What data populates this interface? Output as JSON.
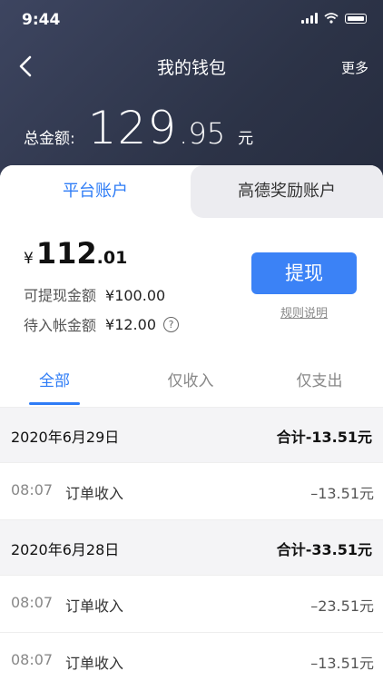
{
  "status": {
    "time": "9:44"
  },
  "nav": {
    "title": "我的钱包",
    "more": "更多"
  },
  "total": {
    "label": "总金额:",
    "int": "129",
    "dec": ".95",
    "unit": "元"
  },
  "account_tabs": {
    "active": "平台账户",
    "inactive": "高德奖励账户"
  },
  "balance": {
    "currency": "¥",
    "int": "112",
    "dec": ".01"
  },
  "withdrawable": {
    "label": "可提现金额",
    "value": "¥100.00"
  },
  "pending": {
    "label": "待入帐金额",
    "value": "¥12.00",
    "help": "?"
  },
  "actions": {
    "withdraw": "提现",
    "rules": "规则说明"
  },
  "filters": [
    "全部",
    "仅收入",
    "仅支出"
  ],
  "groups": [
    {
      "date": "2020年6月29日",
      "sum": "合计-13.51元",
      "rows": [
        {
          "time": "08:07",
          "name": "订单收入",
          "amount": "–13.51元"
        }
      ]
    },
    {
      "date": "2020年6月28日",
      "sum": "合计-33.51元",
      "rows": [
        {
          "time": "08:07",
          "name": "订单收入",
          "amount": "–23.51元"
        },
        {
          "time": "08:07",
          "name": "订单收入",
          "amount": "–13.51元"
        }
      ]
    }
  ]
}
